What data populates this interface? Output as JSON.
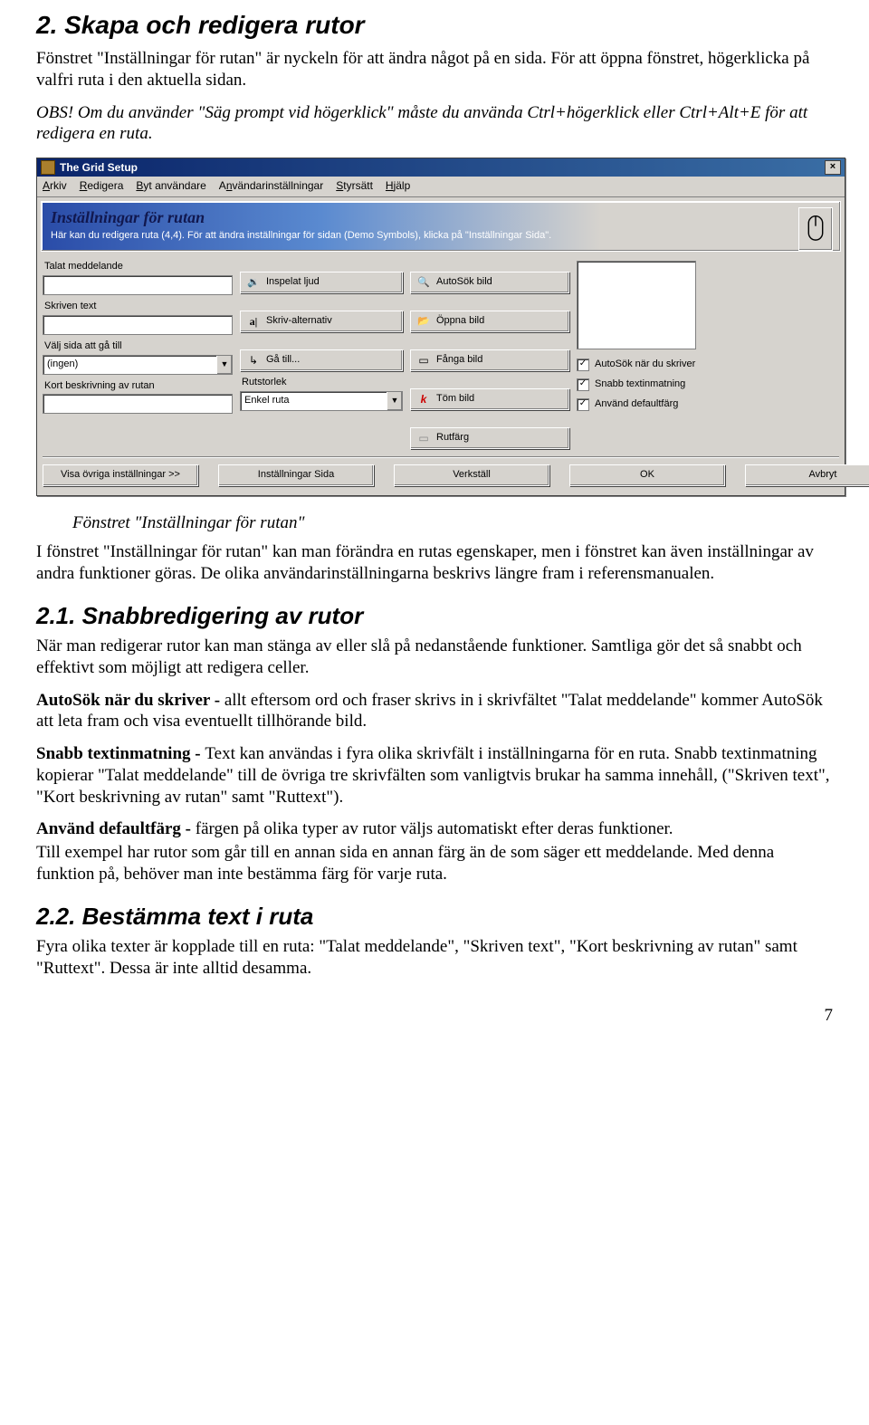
{
  "heading_main": "2. Skapa och redigera rutor",
  "intro": "Fönstret \"Inställningar för rutan\" är nyckeln för att ändra något på en sida. För att öppna fönstret, högerklicka på valfri ruta i den aktuella sidan.",
  "obs": "OBS! Om du använder \"Säg prompt vid högerklick\" måste du använda Ctrl+högerklick eller Ctrl+Alt+E för att redigera en ruta.",
  "win": {
    "title": "The Grid Setup",
    "menu": {
      "arkiv": "Arkiv",
      "redigera": "Redigera",
      "byt": "Byt användare",
      "anv": "Användarinställningar",
      "styr": "Styrsätt",
      "hjalp": "Hjälp"
    },
    "banner_title": "Inställningar för rutan",
    "banner_sub": "Här kan du redigera ruta (4,4). För att ändra inställningar för sidan (Demo Symbols), klicka på \"Inställningar Sida\".",
    "labels": {
      "talat": "Talat meddelande",
      "skriven": "Skriven text",
      "valjsida": "Välj sida att gå till",
      "kort": "Kort beskrivning av rutan",
      "rutstorlek": "Rutstorlek"
    },
    "sel": {
      "ingen": "(ingen)",
      "enkel": "Enkel ruta"
    },
    "btn": {
      "inspelat": "Inspelat ljud",
      "skrivalt": "Skriv-alternativ",
      "gatill": "Gå till...",
      "autosokbild": "AutoSök bild",
      "oppnabild": "Öppna bild",
      "fangabild": "Fånga bild",
      "tombild": "Töm bild",
      "rutfarg": "Rutfärg"
    },
    "chk": {
      "autosok": "AutoSök när du skriver",
      "snabb": "Snabb textinmatning",
      "defaultfarg": "Använd defaultfärg"
    },
    "footer": {
      "visa": "Visa övriga inställningar >>",
      "sida": "Inställningar Sida",
      "verkstall": "Verkställ",
      "ok": "OK",
      "avbryt": "Avbryt"
    }
  },
  "caption": "Fönstret \"Inställningar för rutan\"",
  "p_after_window": "I fönstret \"Inställningar för rutan\" kan man förändra en rutas egenskaper, men i fönstret kan även inställningar av andra funktioner göras. De olika användarinställningarna beskrivs längre fram i referensmanualen.",
  "h21": "2.1. Snabbredigering av rutor",
  "p21a": "När man redigerar rutor kan man stänga av eller slå på nedanstående funktioner. Samtliga gör det så snabbt och effektivt som möjligt att redigera celler.",
  "p21b_lead": "AutoSök när du skriver - ",
  "p21b_rest": "allt eftersom ord och fraser skrivs in i skrivfältet \"Talat meddelande\" kommer AutoSök att leta fram och visa eventuellt tillhörande bild.",
  "p21c_lead": "Snabb textinmatning - ",
  "p21c_rest": "Text kan användas i fyra olika skrivfält i inställningarna för en ruta. Snabb textinmatning kopierar \"Talat meddelande\" till de övriga tre skrivfälten som vanligtvis brukar ha samma innehåll, (\"Skriven text\", \"Kort beskrivning av rutan\" samt \"Ruttext\").",
  "p21d_lead": "Använd defaultfärg - ",
  "p21d_rest": "färgen på olika typer av rutor väljs automatiskt efter deras funktioner.",
  "p21e": "Till exempel har rutor som går till en annan sida en annan färg än de som säger ett meddelande. Med denna funktion på, behöver man inte bestämma färg för varje ruta.",
  "h22": "2.2. Bestämma text i ruta",
  "p22": "Fyra olika texter är kopplade till en ruta: \"Talat meddelande\", \"Skriven text\", \"Kort beskrivning av rutan\" samt \"Ruttext\". Dessa är inte alltid desamma.",
  "pageNo": "7"
}
